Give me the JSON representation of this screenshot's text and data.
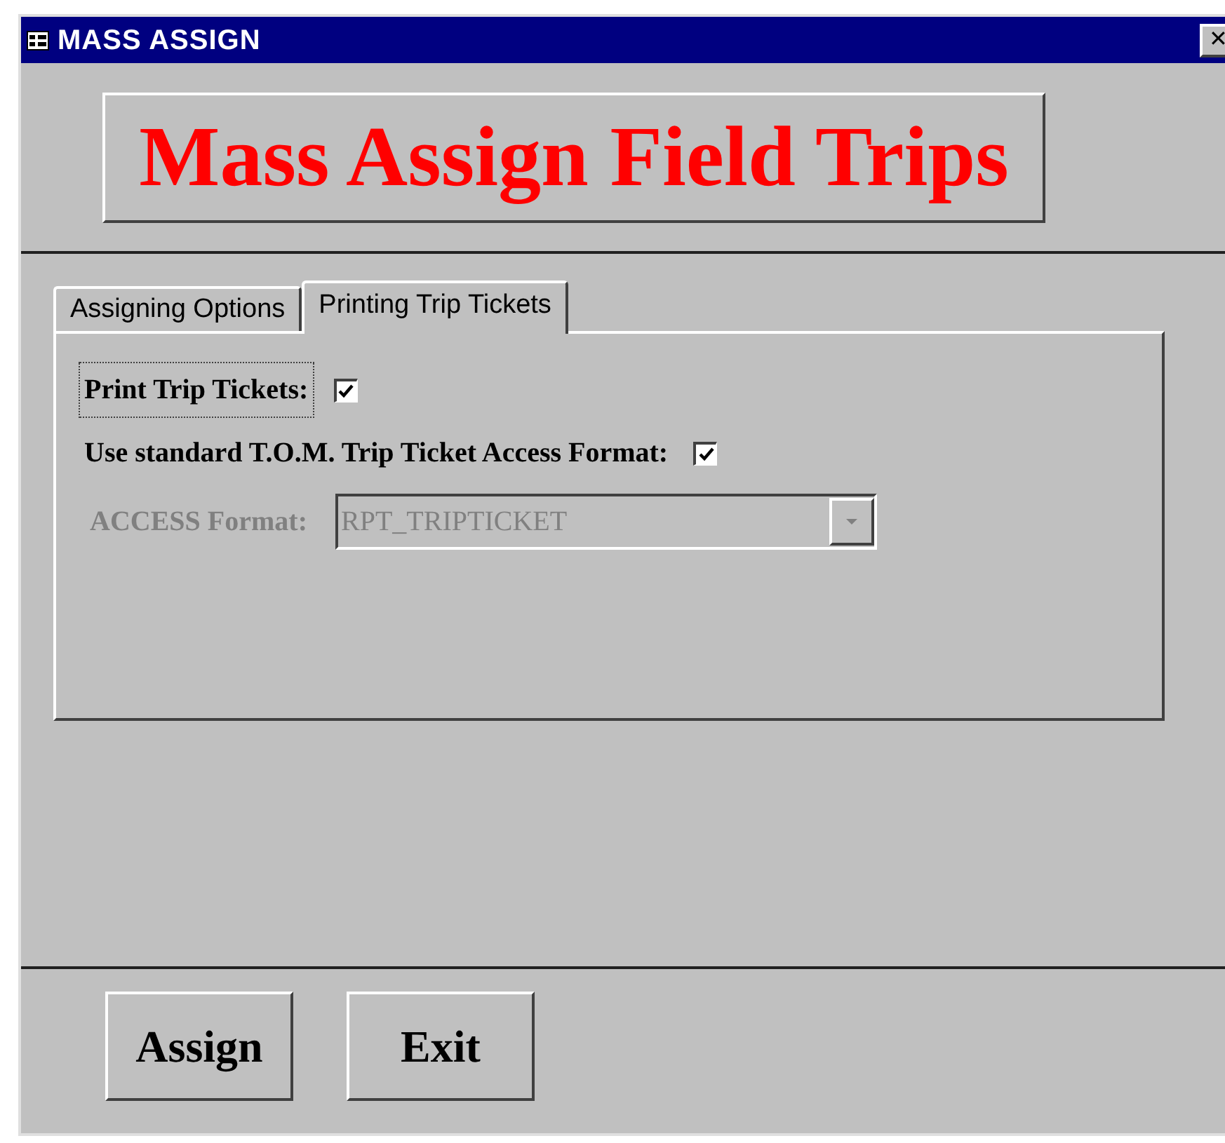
{
  "window": {
    "title": "MASS ASSIGN",
    "close": "✕"
  },
  "header": {
    "title": "Mass Assign Field Trips"
  },
  "tabs": [
    {
      "label": "Assigning Options",
      "selected": false
    },
    {
      "label": "Printing Trip Tickets",
      "selected": true
    }
  ],
  "options": [
    {
      "label": "Print Trip Tickets:",
      "checked": true,
      "focused": true
    },
    {
      "label": "Use standard T.O.M. Trip Ticket Access Format:",
      "checked": true,
      "focused": false
    }
  ],
  "access_format": {
    "label": "ACCESS Format:",
    "value": "RPT_TRIPTICKET",
    "disabled": true
  },
  "buttons": [
    "Assign",
    "Exit"
  ]
}
